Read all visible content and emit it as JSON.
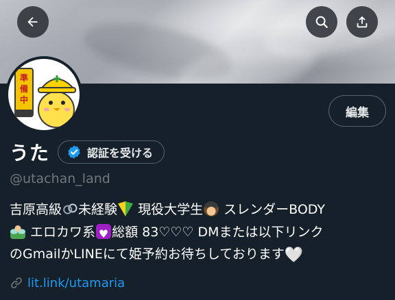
{
  "header": {
    "back_icon": "arrow-left-icon",
    "search_icon": "search-icon",
    "share_icon": "share-upload-icon"
  },
  "avatar": {
    "sign_text": "準備中"
  },
  "actions": {
    "edit_label": "編集"
  },
  "profile": {
    "display_name": "うた",
    "verify_label": "認証を受ける",
    "handle": "@utachan_land"
  },
  "bio": {
    "line1_a": "吉原高級",
    "line1_b": "未経験",
    "line1_c": "現役大学生",
    "line1_d": "スレンダーBODY",
    "line2_a": "エロカワ系",
    "line2_b": "総額 83♡♡♡ DMまたは以下リンク",
    "line3_a": "のGmailかLINEにて姫予約お待ちしております",
    "line3_heart": "🤍"
  },
  "link": {
    "text": "lit.link/utamaria"
  },
  "colors": {
    "background": "#15202b",
    "accent": "#1d9bf0",
    "muted": "#71767b",
    "border": "#536471"
  }
}
